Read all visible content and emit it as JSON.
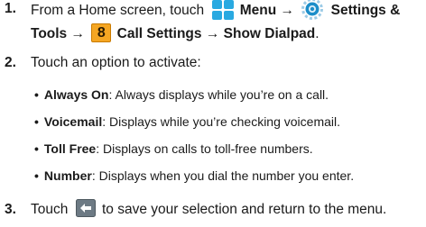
{
  "steps": [
    {
      "number": "1.",
      "text_start": "From a Home screen, touch",
      "menu_label": "Menu",
      "arrow1": "→",
      "settings_label": "Settings &",
      "tools_label": "Tools",
      "arrow2": "→",
      "key_label": "8",
      "call_settings_label": "Call Settings",
      "arrow3": "→",
      "show_dialpad_label": "Show Dialpad",
      "period": "."
    },
    {
      "number": "2.",
      "text": "Touch an option to activate:",
      "options": [
        {
          "name": "Always On",
          "desc": ": Always displays while you’re on a call."
        },
        {
          "name": "Voicemail",
          "desc": ": Displays while you’re checking voicemail."
        },
        {
          "name": "Toll Free",
          "desc": ": Displays on calls to toll-free numbers."
        },
        {
          "name": "Number",
          "desc": ": Displays when you dial the number you enter."
        }
      ]
    },
    {
      "number": "3.",
      "text_start": "Touch",
      "text_end": "to save your selection and return to the menu."
    }
  ],
  "icons": {
    "menu": "menu-grid-icon",
    "settings": "settings-gear-icon",
    "key": "numeric-key-icon",
    "back": "back-arrow-icon"
  },
  "colors": {
    "menu_icon": "#29a9e1",
    "gear_icon": "#1c8ec9",
    "key_fill": "#f5a623",
    "key_border": "#c97a00",
    "back_button": "#6d7a84"
  }
}
